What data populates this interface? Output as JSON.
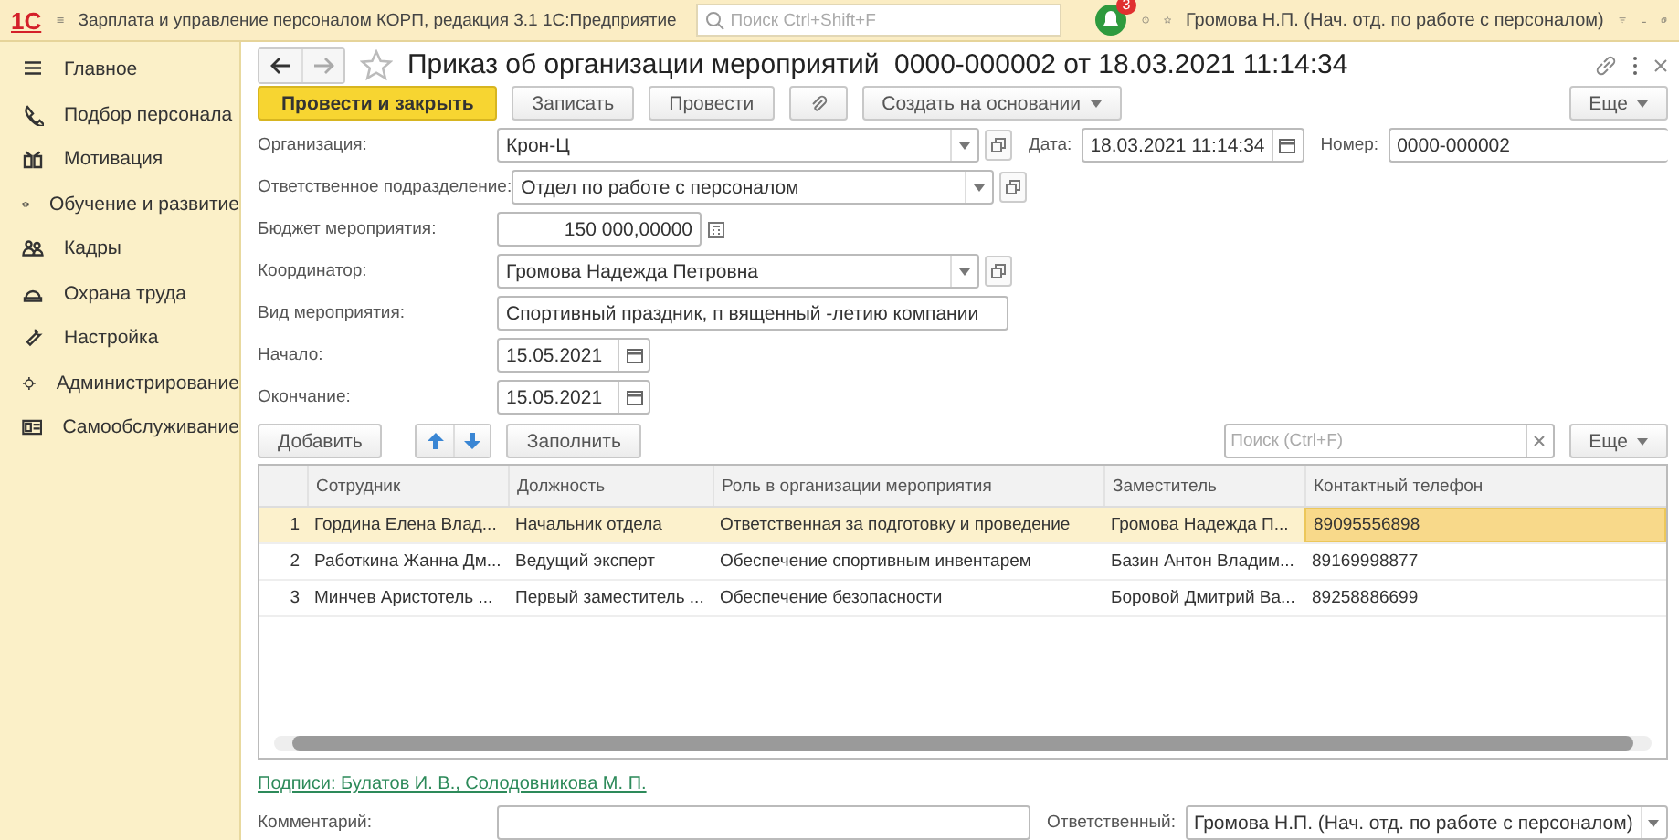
{
  "top_bar": {
    "logo": "1С",
    "title": "Зарплата и управление персоналом КОРП, редакция 3.1 1С:Предприятие",
    "search": {
      "placeholder": "Поиск Ctrl+Shift+F"
    },
    "notifications": "3",
    "user": "Громова Н.П. (Нач. отд. по работе с персоналом)"
  },
  "sidebar": {
    "items": [
      {
        "label": "Главное"
      },
      {
        "label": "Подбор персонала"
      },
      {
        "label": "Мотивация"
      },
      {
        "label": "Обучение и развитие"
      },
      {
        "label": "Кадры"
      },
      {
        "label": "Охрана труда"
      },
      {
        "label": "Настройка"
      },
      {
        "label": "Администрирование"
      },
      {
        "label": "Самообслуживание"
      }
    ]
  },
  "document": {
    "title": "Приказ об организации мероприятий  0000-000002 от 18.03.2021 11:14:34",
    "toolbar": [
      {
        "kind": "primary",
        "label": "Провести и закрыть"
      },
      {
        "kind": "button",
        "label": "Записать"
      },
      {
        "kind": "button",
        "label": "Провести"
      },
      {
        "kind": "attach"
      },
      {
        "kind": "dropdown",
        "label": "Создать на основании"
      }
    ],
    "more": "Еще",
    "fields": [
      {
        "label": "Организация:",
        "value": "Крон-Ц",
        "kind": "select",
        "side_fields": [
          {
            "label": "Дата:",
            "value": "18.03.2021 11:14:34",
            "kind": "datetime"
          },
          {
            "label": "Номер:",
            "value": "0000-000002",
            "kind": "text"
          }
        ]
      },
      {
        "label": "Ответственное подразделение:",
        "value": "Отдел по работе с персоналом",
        "kind": "select"
      },
      {
        "label": "Бюджет мероприятия:",
        "value": "150 000,00000",
        "kind": "number"
      },
      {
        "label": "Координатор:",
        "value": "Громова Надежда Петровна",
        "kind": "select"
      },
      {
        "label": "Вид мероприятия:",
        "value": "Спортивный праздник, п вященный -летию компании",
        "kind": "text"
      },
      {
        "label": "Начало:",
        "value": "15.05.2021",
        "kind": "date"
      },
      {
        "label": "Окончание:",
        "value": "15.05.2021",
        "kind": "date"
      }
    ],
    "table_toolbar": {
      "add": "Добавить",
      "fill": "Заполнить",
      "search": {
        "placeholder": "Поиск (Ctrl+F)"
      },
      "more": "Еще"
    },
    "table": {
      "columns": [
        "Сотрудник",
        "Должность",
        "Роль в организации мероприятия",
        "Заместитель",
        "Контактный телефон"
      ],
      "rows": [
        {
          "number": "1",
          "cells": [
            "Гордина Елена Влад...",
            "Начальник отдела",
            "Ответственная за подготовку и проведение",
            "Громова Надежда П...",
            "89095556898"
          ],
          "selected": true
        },
        {
          "number": "2",
          "cells": [
            "Работкина Жанна Дм...",
            "Ведущий эксперт",
            "Обеспечение  спортивным инвентарем",
            "Базин Антон Владим...",
            "89169998877"
          ],
          "selected": false
        },
        {
          "number": "3",
          "cells": [
            "Минчев Аристотель ...",
            "Первый заместитель ...",
            "Обеспечение безопасности",
            "Боровой Дмитрий Ва...",
            "89258886699"
          ],
          "selected": false
        }
      ]
    },
    "signatures_link": "Подписи: Булатов И. В., Солодовникова М. П.",
    "comment": {
      "label": "Комментарий:"
    },
    "responsible": {
      "label": "Ответственный:",
      "value": "Громова Н.П. (Нач. отд. по работе с персоналом)"
    }
  }
}
